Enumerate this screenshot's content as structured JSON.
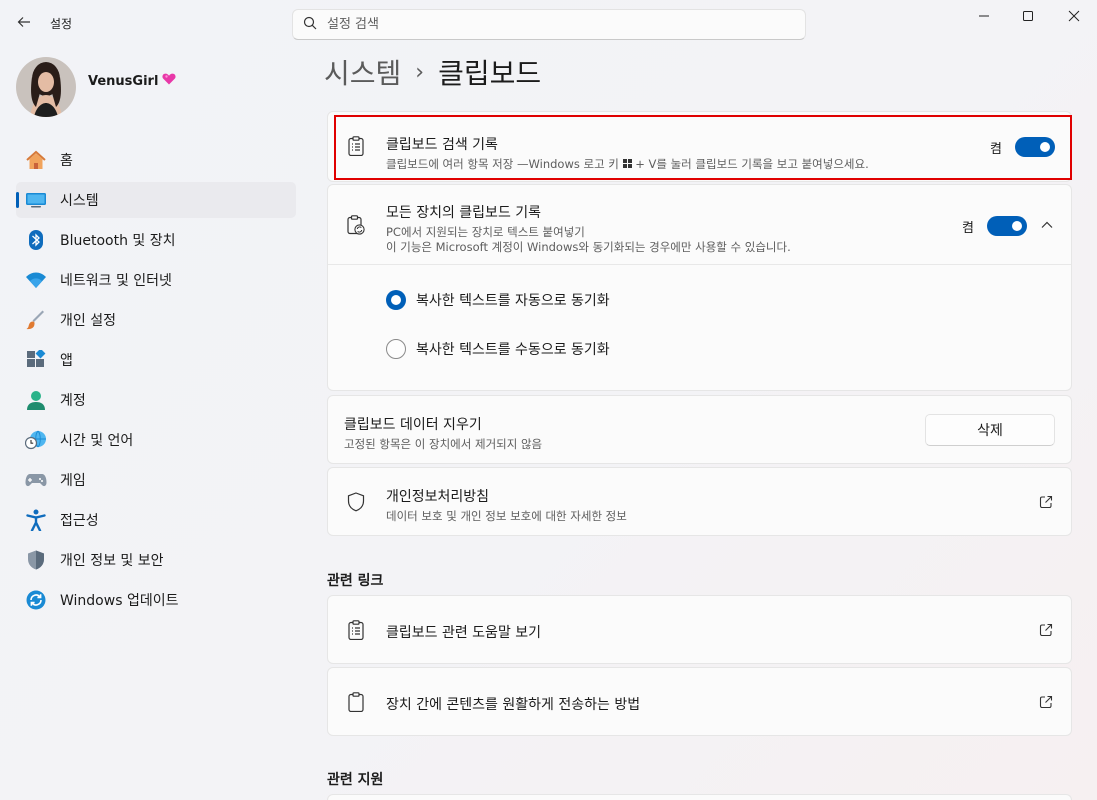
{
  "window": {
    "title": "설정"
  },
  "search": {
    "placeholder": "설정 검색"
  },
  "user": {
    "name": "VenusGirl"
  },
  "sidebar": {
    "items": [
      {
        "label": "홈",
        "icon": "home-icon"
      },
      {
        "label": "시스템",
        "icon": "system-icon"
      },
      {
        "label": "Bluetooth 및 장치",
        "icon": "bluetooth-icon"
      },
      {
        "label": "네트워크 및 인터넷",
        "icon": "wifi-icon"
      },
      {
        "label": "개인 설정",
        "icon": "brush-icon"
      },
      {
        "label": "앱",
        "icon": "apps-icon"
      },
      {
        "label": "계정",
        "icon": "account-icon"
      },
      {
        "label": "시간 및 언어",
        "icon": "clock-globe-icon"
      },
      {
        "label": "게임",
        "icon": "gamepad-icon"
      },
      {
        "label": "접근성",
        "icon": "accessibility-icon"
      },
      {
        "label": "개인 정보 및 보안",
        "icon": "shield-icon"
      },
      {
        "label": "Windows 업데이트",
        "icon": "update-icon"
      }
    ]
  },
  "breadcrumb": {
    "parent": "시스템",
    "separator": "›",
    "current": "클립보드"
  },
  "history": {
    "title": "클립보드 검색 기록",
    "subtitle_before": "클립보드에 여러 항목 저장 —Windows 로고 키 ",
    "subtitle_after": " + V를 눌러 클립보드 기록을 보고 붙여넣으세요.",
    "toggle_label": "켬"
  },
  "sync": {
    "title": "모든 장치의 클립보드 기록",
    "subtitle1": "PC에서 지원되는 장치로 텍스트 붙여넣기",
    "subtitle2": "이 기능은 Microsoft 계정이 Windows와 동기화되는 경우에만 사용할 수 있습니다.",
    "toggle_label": "켬",
    "options": [
      {
        "label": "복사한 텍스트를 자동으로 동기화",
        "selected": true
      },
      {
        "label": "복사한 텍스트를 수동으로 동기화",
        "selected": false
      }
    ]
  },
  "clear": {
    "title": "클립보드 데이터 지우기",
    "subtitle": "고정된 항목은 이 장치에서 제거되지 않음",
    "button": "삭제"
  },
  "privacy": {
    "title": "개인정보처리방침",
    "subtitle": "데이터 보호 및 개인 정보 보호에 대한 자세한 정보"
  },
  "related_links": {
    "heading": "관련 링크",
    "items": [
      {
        "label": "클립보드 관련 도움말 보기"
      },
      {
        "label": "장치 간에 콘텐츠를 원활하게 전송하는 방법"
      }
    ]
  },
  "related_support": {
    "heading": "관련 지원"
  },
  "colors": {
    "accent": "#005fb8",
    "highlight": "#e00000"
  }
}
